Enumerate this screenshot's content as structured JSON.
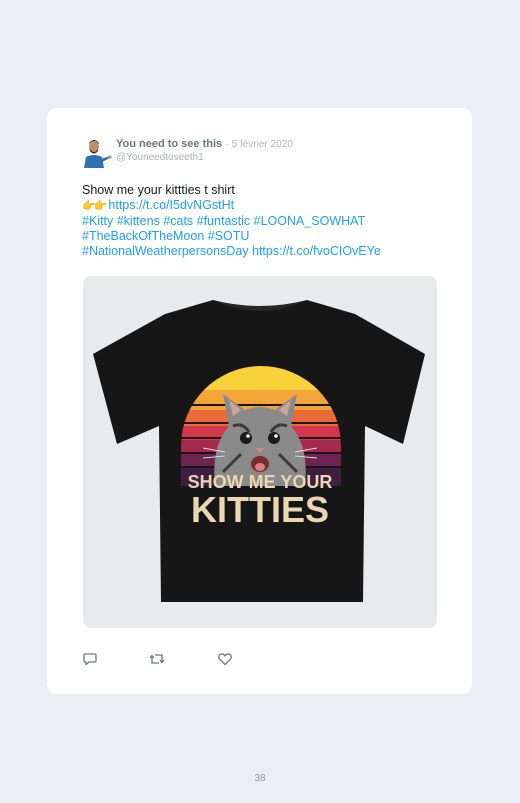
{
  "tweet": {
    "author_name": "You need to see this",
    "separator": "·",
    "date": "5 février 2020",
    "handle": "@Youneedtoseeth1",
    "text_line1": "Show me your kittties t shirt",
    "emoji": "👉👉",
    "link1": "https://t.co/I5dvNGstHt",
    "hashtags_line1": "#Kitty #kittens #cats #funtastic #LOONA_SOWHAT",
    "hashtags_line2": "#TheBackOfTheMoon #SOTU",
    "hashtags_line3": "#NationalWeatherpersonsDay https://t.co/fvoCIOvEYe"
  },
  "media": {
    "shirt_print_line1": "SHOW ME YOUR",
    "shirt_print_line2": "KITTIES"
  },
  "actions": {
    "reply_icon": "reply-icon",
    "retweet_icon": "retweet-icon",
    "like_icon": "heart-icon"
  },
  "page": {
    "number": "38"
  },
  "colors": {
    "page_bg": "#eceef3",
    "card_bg": "#ffffff",
    "link": "#1da1f2",
    "shirt": "#161616"
  }
}
